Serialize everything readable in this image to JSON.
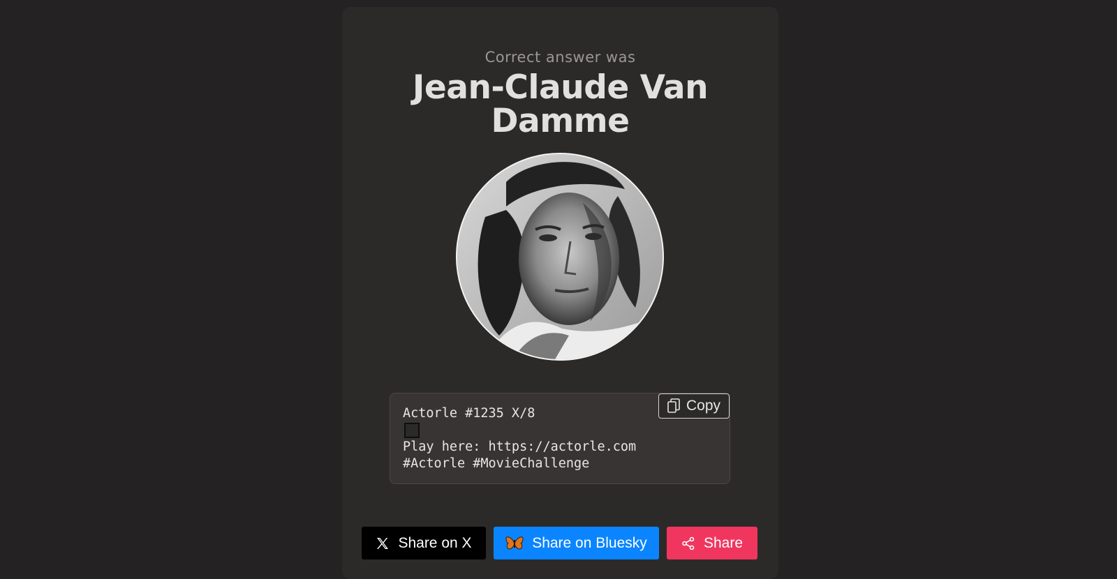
{
  "result": {
    "subtitle": "Correct answer was",
    "answer": "Jean-Claude Van Damme",
    "portrait_alt": "Jean-Claude Van Damme"
  },
  "share_box": {
    "line1": "Actorle #1235 X/8",
    "line3": "Play here: https://actorle.com",
    "line4": "#Actorle #MovieChallenge",
    "copy_label": "Copy",
    "copy_icon": "copy-icon"
  },
  "share_buttons": {
    "x_label": "Share on X",
    "x_icon": "x-logo-icon",
    "bluesky_label": "Share on Bluesky",
    "bluesky_icon": "butterfly-icon",
    "share_label": "Share",
    "share_icon": "share-icon"
  },
  "colors": {
    "page_bg": "#242223",
    "card_bg": "#2c2a29",
    "x_button": "#000000",
    "bluesky_button": "#0a85ff",
    "share_button": "#f0365e"
  }
}
